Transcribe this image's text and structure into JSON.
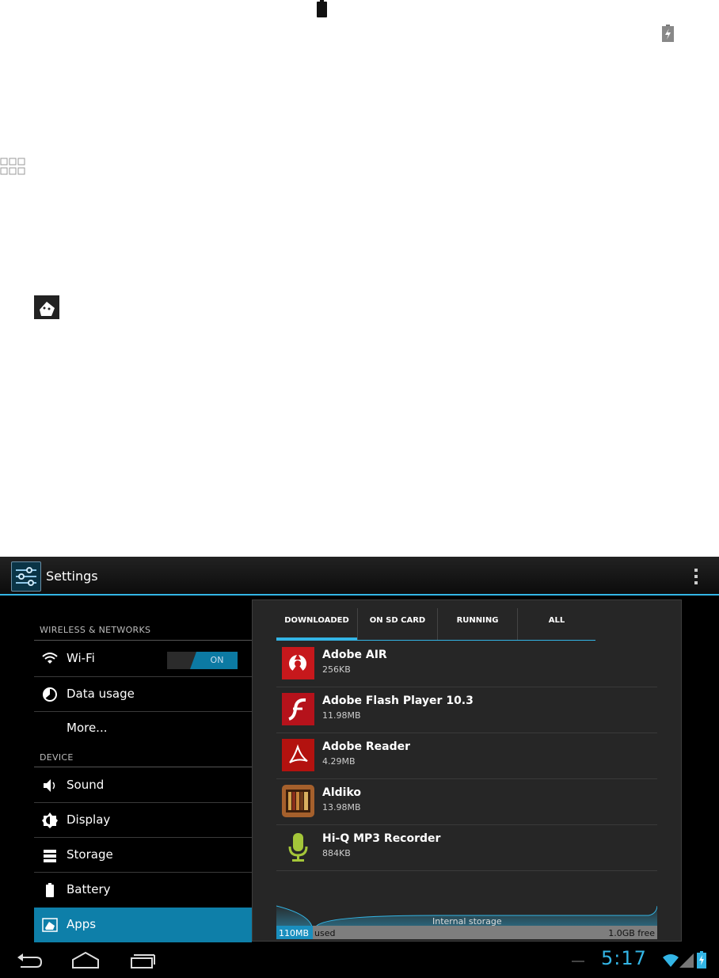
{
  "actionbar": {
    "title": "Settings"
  },
  "sidebar": {
    "sections": [
      {
        "header": "WIRELESS & NETWORKS"
      },
      {
        "header": "DEVICE"
      }
    ],
    "items": [
      {
        "label": "Wi-Fi",
        "icon": "wifi-icon"
      },
      {
        "label": "Data usage",
        "icon": "data-usage-icon"
      },
      {
        "label": "More..."
      },
      {
        "label": "Sound",
        "icon": "sound-icon"
      },
      {
        "label": "Display",
        "icon": "display-icon"
      },
      {
        "label": "Storage",
        "icon": "storage-icon"
      },
      {
        "label": "Battery",
        "icon": "battery-icon"
      },
      {
        "label": "Apps",
        "icon": "apps-icon",
        "selected": true
      }
    ],
    "wifi_toggle": "ON"
  },
  "tabs": [
    {
      "label": "DOWNLOADED",
      "selected": true
    },
    {
      "label": "ON SD CARD"
    },
    {
      "label": "RUNNING"
    },
    {
      "label": "ALL"
    }
  ],
  "apps": [
    {
      "name": "Adobe AIR",
      "size": "256KB",
      "icon": "adobe-air-icon"
    },
    {
      "name": "Adobe Flash Player 10.3",
      "size": "11.98MB",
      "icon": "flash-player-icon"
    },
    {
      "name": "Adobe Reader",
      "size": "4.29MB",
      "icon": "adobe-reader-icon"
    },
    {
      "name": "Aldiko",
      "size": "13.98MB",
      "icon": "aldiko-icon"
    },
    {
      "name": "Hi-Q MP3 Recorder",
      "size": "884KB",
      "icon": "microphone-icon"
    }
  ],
  "storage": {
    "label": "Internal storage",
    "used": "110MB",
    "used_word": "used",
    "free": "1.0GB free",
    "used_fraction": 0.1
  },
  "statusbar": {
    "time": "5:17"
  },
  "colors": {
    "accent": "#33b5e5",
    "selected": "#0e7fa9"
  }
}
